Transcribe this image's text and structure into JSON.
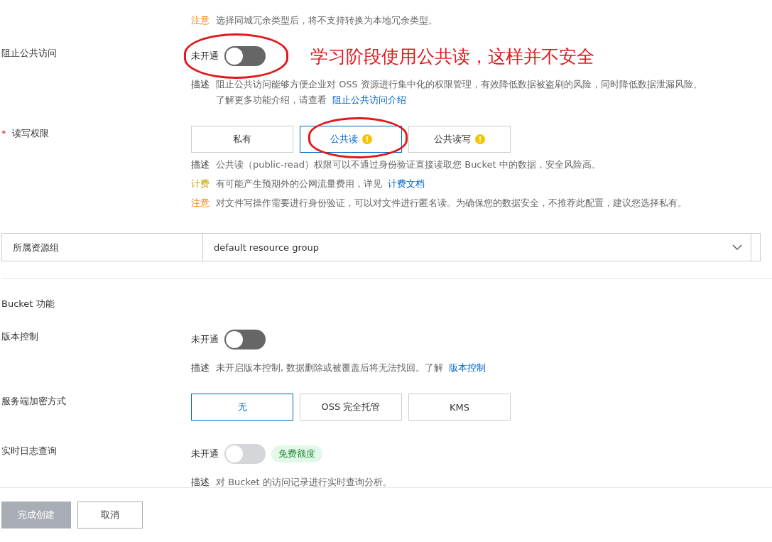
{
  "top_note": {
    "tag": "注意",
    "kind": "warn",
    "text": "选择同城冗余类型后，将不支持转换为本地冗余类型。"
  },
  "rows": [
    {
      "kind": "toggle",
      "label": "阻止公共访问",
      "state_text": "未开通",
      "on": false,
      "disabled": false,
      "circled": true,
      "annotation": "学习阶段使用公共读，这样并不安全",
      "notes": [
        {
          "tag": "描述",
          "kind": "desc",
          "text": "阻止公共访问能够方便企业对 OSS 资源进行集中化的权限管理，有效降低数据被盗刷的风险，同时降低数据泄漏风险。",
          "more": "了解更多功能介绍，请查看",
          "link": "阻止公共访问介绍"
        }
      ]
    },
    {
      "kind": "segmented",
      "label": "读写权限",
      "required_mark": "*",
      "options": [
        {
          "label": "私有",
          "selected": false,
          "warning": false,
          "circled": false
        },
        {
          "label": "公共读",
          "selected": true,
          "warning": true,
          "circled": true
        },
        {
          "label": "公共读写",
          "selected": false,
          "warning": true,
          "circled": false
        }
      ],
      "notes": [
        {
          "tag": "描述",
          "kind": "desc",
          "text": "公共读（public-read）权限可以不通过身份验证直接读取您 Bucket 中的数据，安全风险高。"
        },
        {
          "tag": "计费",
          "kind": "fee",
          "text": "有可能产生预期外的公网流量费用，详见",
          "link": "计费文档"
        },
        {
          "tag": "注意",
          "kind": "warn",
          "text": "对文件写操作需要进行身份验证，可以对文件进行匿名读。为确保您的数据安全，不推荐此配置，建议您选择私有。"
        }
      ]
    },
    {
      "kind": "select",
      "label": "所属资源组",
      "value": "default resource group"
    },
    {
      "kind": "divider"
    },
    {
      "kind": "heading",
      "label": "Bucket 功能"
    },
    {
      "kind": "toggle",
      "label": "版本控制",
      "state_text": "未开通",
      "on": false,
      "disabled": false,
      "circled": false,
      "notes": [
        {
          "tag": "描述",
          "kind": "desc",
          "text": "未开启版本控制, 数据删除或被覆盖后将无法找回。了解",
          "link": "版本控制"
        }
      ]
    },
    {
      "kind": "segmented",
      "label": "服务端加密方式",
      "options": [
        {
          "label": "无",
          "selected": true,
          "warning": false,
          "circled": false
        },
        {
          "label": "OSS 完全托管",
          "selected": false,
          "warning": false,
          "circled": false
        },
        {
          "label": "KMS",
          "selected": false,
          "warning": false,
          "circled": false
        }
      ]
    },
    {
      "kind": "toggle",
      "label": "实时日志查询",
      "state_text": "未开通",
      "on": false,
      "disabled": true,
      "circled": false,
      "badge": "免费额度",
      "notes": [
        {
          "tag": "描述",
          "kind": "desc",
          "text": "对 Bucket 的访问记录进行实时查询分析。"
        }
      ]
    }
  ],
  "footer": [
    {
      "label": "完成创建",
      "disabled": true
    },
    {
      "label": "取消",
      "disabled": false
    }
  ]
}
